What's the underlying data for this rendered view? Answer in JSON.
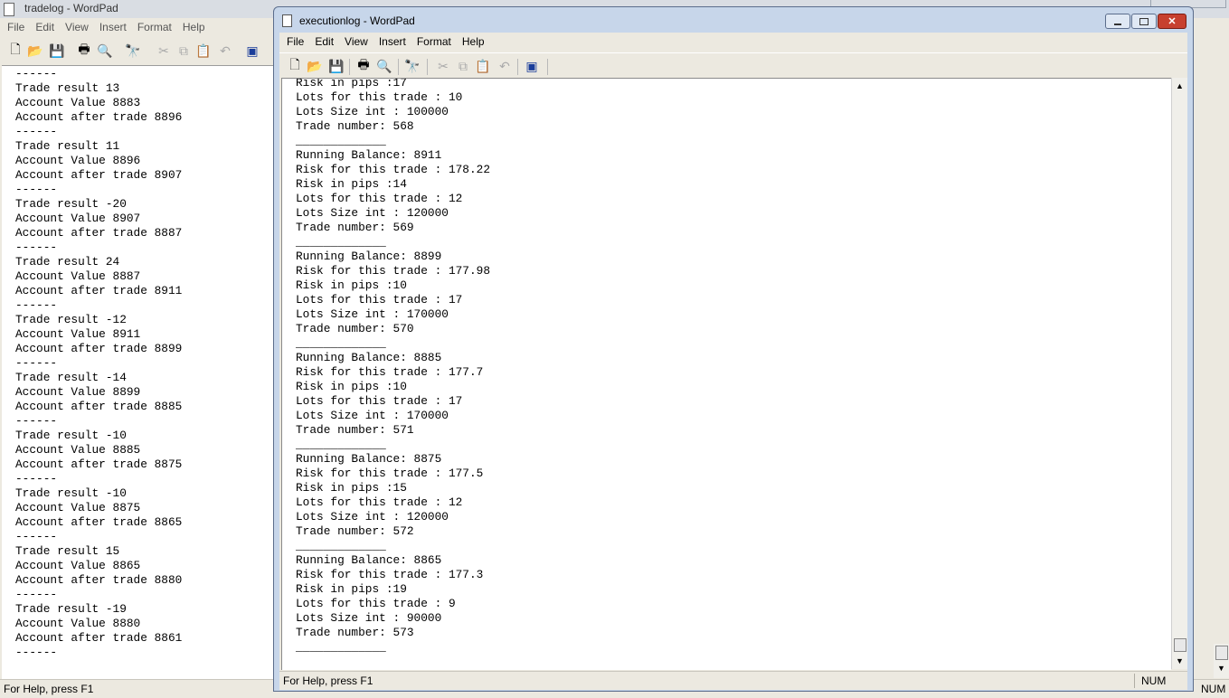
{
  "tradelog": {
    "title": "tradelog - WordPad",
    "menu": [
      "File",
      "Edit",
      "View",
      "Insert",
      "Format",
      "Help"
    ],
    "lines": [
      "------",
      "Trade result 13",
      "Account Value 8883",
      "Account after trade 8896",
      "------",
      "Trade result 11",
      "Account Value 8896",
      "Account after trade 8907",
      "------",
      "Trade result -20",
      "Account Value 8907",
      "Account after trade 8887",
      "------",
      "Trade result 24",
      "Account Value 8887",
      "Account after trade 8911",
      "------",
      "Trade result -12",
      "Account Value 8911",
      "Account after trade 8899",
      "------",
      "Trade result -14",
      "Account Value 8899",
      "Account after trade 8885",
      "------",
      "Trade result -10",
      "Account Value 8885",
      "Account after trade 8875",
      "------",
      "Trade result -10",
      "Account Value 8875",
      "Account after trade 8865",
      "------",
      "Trade result 15",
      "Account Value 8865",
      "Account after trade 8880",
      "------",
      "Trade result -19",
      "Account Value 8880",
      "Account after trade 8861",
      "------"
    ],
    "status": "For Help, press F1",
    "num_indicator": "NUM"
  },
  "executionlog": {
    "title": "executionlog - WordPad",
    "menu": [
      "File",
      "Edit",
      "View",
      "Insert",
      "Format",
      "Help"
    ],
    "lines": [
      "Risk in pips :17",
      "Lots for this trade : 10",
      "Lots Size int : 100000",
      "Trade number: 568",
      "_____________",
      "Running Balance: 8911",
      "Risk for this trade : 178.22",
      "Risk in pips :14",
      "Lots for this trade : 12",
      "Lots Size int : 120000",
      "Trade number: 569",
      "_____________",
      "Running Balance: 8899",
      "Risk for this trade : 177.98",
      "Risk in pips :10",
      "Lots for this trade : 17",
      "Lots Size int : 170000",
      "Trade number: 570",
      "_____________",
      "Running Balance: 8885",
      "Risk for this trade : 177.7",
      "Risk in pips :10",
      "Lots for this trade : 17",
      "Lots Size int : 170000",
      "Trade number: 571",
      "_____________",
      "Running Balance: 8875",
      "Risk for this trade : 177.5",
      "Risk in pips :15",
      "Lots for this trade : 12",
      "Lots Size int : 120000",
      "Trade number: 572",
      "_____________",
      "Running Balance: 8865",
      "Risk for this trade : 177.3",
      "Risk in pips :19",
      "Lots for this trade : 9",
      "Lots Size int : 90000",
      "Trade number: 573",
      "_____________"
    ],
    "status": "For Help, press F1",
    "num_indicator": "NUM"
  },
  "icons": [
    "new-document-icon",
    "open-icon",
    "save-icon",
    "print-icon",
    "print-preview-icon",
    "find-icon",
    "cut-icon",
    "copy-icon",
    "paste-icon",
    "undo-icon",
    "insert-object-icon"
  ]
}
